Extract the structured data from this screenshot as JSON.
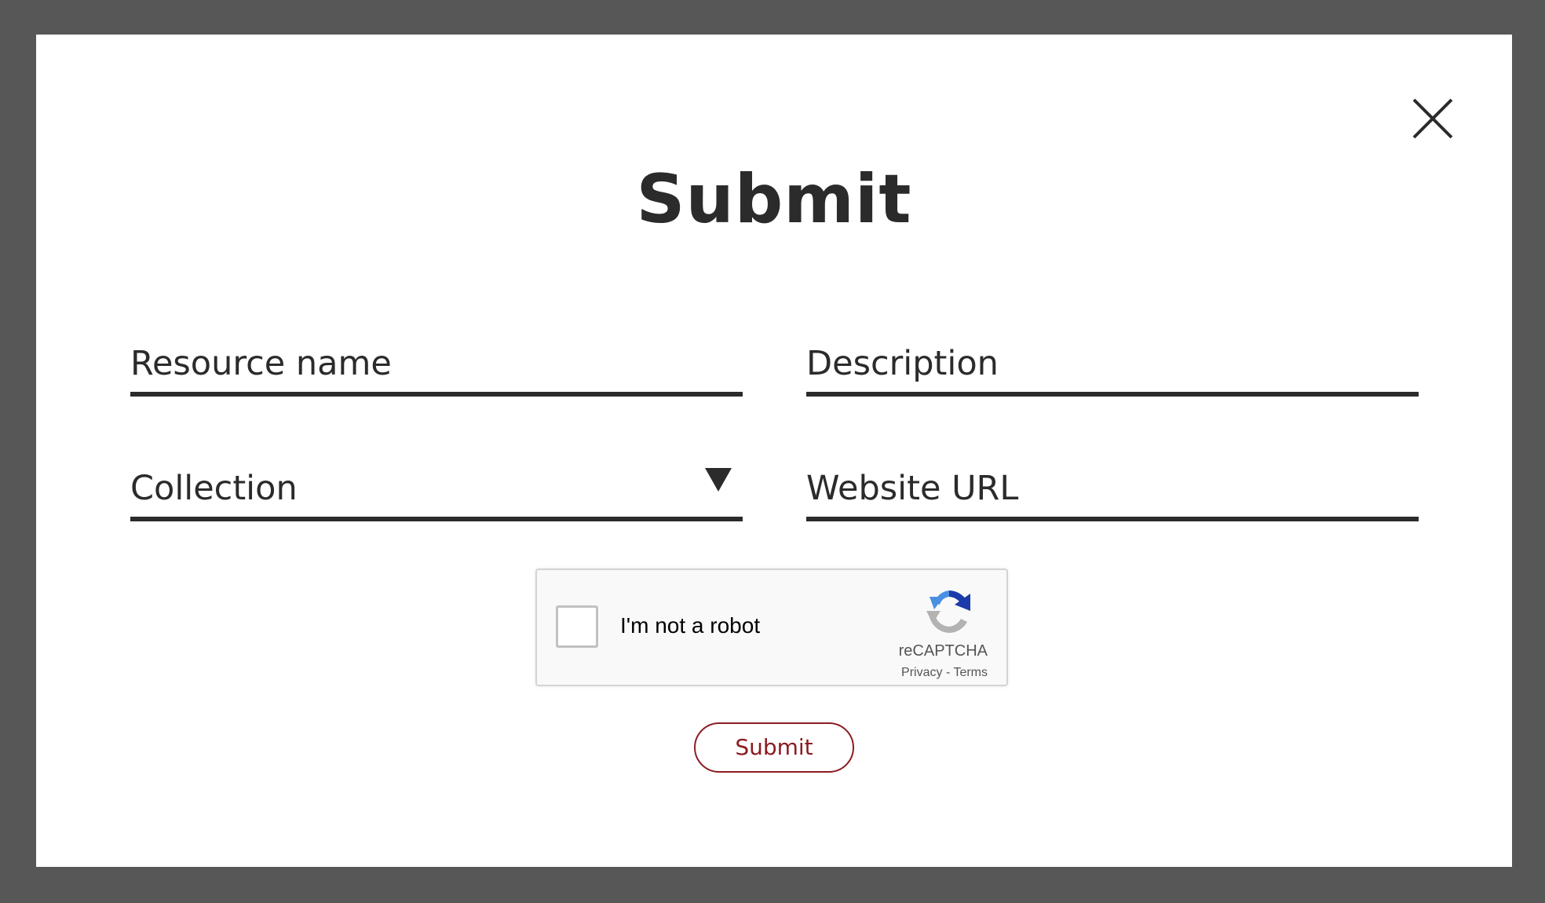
{
  "modal": {
    "title": "Submit",
    "close_icon": "close-icon"
  },
  "form": {
    "resource_name": {
      "placeholder": "Resource name",
      "value": ""
    },
    "description": {
      "placeholder": "Description",
      "value": ""
    },
    "collection": {
      "selected": "Collection",
      "arrow_icon": "triangle-down-icon"
    },
    "website_url": {
      "placeholder": "Website URL",
      "value": ""
    },
    "submit_label": "Submit"
  },
  "recaptcha": {
    "label": "I'm not a robot",
    "brand": "reCAPTCHA",
    "privacy": "Privacy",
    "separator": " - ",
    "terms": "Terms",
    "logo_icon": "recaptcha-logo-icon",
    "checked": false
  },
  "colors": {
    "overlay": "#575757",
    "modal_bg": "#ffffff",
    "text": "#2b2b2b",
    "accent": "#8b1c22",
    "recaptcha_blue": "#4a90e2",
    "recaptcha_dark_blue": "#1c3aa9",
    "recaptcha_gray": "#b3b3b3"
  }
}
